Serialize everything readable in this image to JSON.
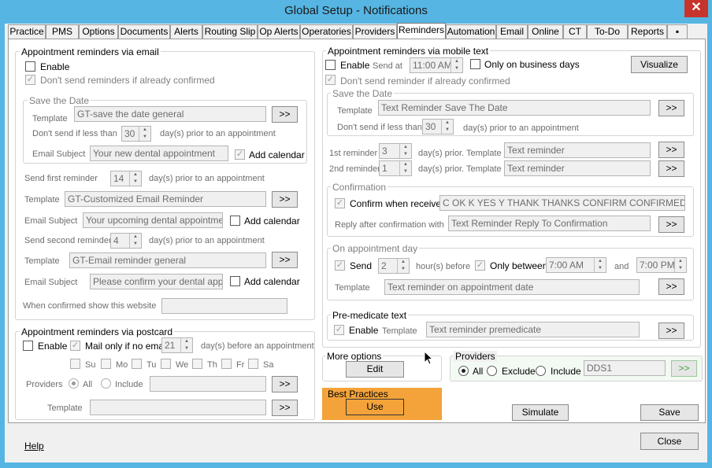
{
  "window": {
    "title": "Global Setup - Notifications",
    "close": "✕"
  },
  "tabs": [
    "Practice",
    "PMS",
    "Options",
    "Documents",
    "Alerts",
    "Routing Slip",
    "Op Alerts",
    "Operatories",
    "Providers",
    "Reminders",
    "Automation",
    "Email",
    "Online",
    "CT",
    "To-Do",
    "Reports",
    "▪"
  ],
  "email": {
    "title": "Appointment reminders via email",
    "enable": "Enable",
    "dont_send": "Don't send reminders  if already confirmed",
    "std": {
      "title": "Save the Date",
      "template_label": "Template",
      "template": "GT-save the date general",
      "browse": ">>",
      "less_label": "Don't send if less than",
      "less_value": "30",
      "days_label": "day(s) prior to an appointment",
      "subject_label": "Email Subject",
      "subject": "Your new dental appointment",
      "add_calendar": "Add calendar"
    },
    "first_label": "Send first reminder",
    "first_value": "14",
    "first_days": "day(s) prior to an appointment",
    "template1_label": "Template",
    "template1": "GT-Customized Email Reminder",
    "browse1": ">>",
    "subject1_label": "Email Subject",
    "subject1": "Your upcoming dental appointment",
    "add_calendar1": "Add calendar",
    "second_label": "Send second reminder",
    "second_value": "4",
    "second_days": "day(s) prior to an appointment",
    "template2_label": "Template",
    "template2": "GT-Email reminder general",
    "browse2": ">>",
    "subject2_label": "Email Subject",
    "subject2": "Please confirm your dental appointi",
    "add_calendar2": "Add calendar",
    "website_label": "When confirmed show this website",
    "website": ""
  },
  "postcard": {
    "title": "Appointment reminders via postcard",
    "enable": "Enable",
    "mail_only": "Mail only if no email",
    "days_value": "21",
    "days_label": "day(s) before an appointment",
    "days": [
      "Su",
      "Mo",
      "Tu",
      "We",
      "Th",
      "Fr",
      "Sa"
    ],
    "providers_label": "Providers",
    "all": "All",
    "include": "Include",
    "include_value": "",
    "browse": ">>",
    "template_label": "Template",
    "template": "",
    "browse2": ">>"
  },
  "mobile": {
    "title": "Appointment reminders via mobile text",
    "enable": "Enable",
    "send_at": "Send at",
    "time": "11:00 AM",
    "business_days": "Only on business days",
    "visualize": "Visualize",
    "dont_send": "Don't send reminder  if already confirmed",
    "std": {
      "title": "Save the Date",
      "template_label": "Template",
      "template": "Text Reminder Save The Date",
      "browse": ">>",
      "less_label": "Don't send if less than",
      "less_value": "30",
      "days_label": "day(s) prior to an appointment"
    },
    "r1_label": "1st reminder",
    "r1_value": "3",
    "r1_days": "day(s) prior.",
    "r1_tpl_label": "Template",
    "r1_tpl": "Text reminder",
    "browse1": ">>",
    "r2_label": "2nd reminder",
    "r2_value": "1",
    "r2_days": "day(s) prior.",
    "r2_tpl_label": "Template",
    "r2_tpl": "Text reminder",
    "browse2": ">>",
    "confirmation": {
      "title": "Confirmation",
      "confirm_when": "Confirm when receive",
      "keywords": "C OK K YES Y THANK THANKS CONFIRM CONFIRMED SI",
      "reply_label": "Reply after confirmation with",
      "reply": "Text Reminder Reply To Confirmation",
      "browse": ">>"
    },
    "appt_day": {
      "title": "On appointment day",
      "send": "Send",
      "hours_value": "2",
      "hours_label": "hour(s) before",
      "only_between": "Only between",
      "from": "7:00 AM",
      "and": "and",
      "to": "7:00 PM",
      "template_label": "Template",
      "template": "Text reminder on appointment date",
      "browse": ">>"
    },
    "premed": {
      "title": "Pre-medicate text",
      "enable": "Enable",
      "template_label": "Template",
      "template": "Text reminder premedicate",
      "browse": ">>"
    }
  },
  "more_options": {
    "title": "More options",
    "edit": "Edit"
  },
  "best_practices": {
    "title": "Best Practices",
    "use": "Use"
  },
  "providers": {
    "title": "Providers",
    "all": "All",
    "exclude": "Exclude",
    "include": "Include",
    "value": "DDS1",
    "browse": ">>"
  },
  "buttons": {
    "simulate": "Simulate",
    "save": "Save",
    "close": "Close",
    "help": "Help"
  },
  "check": "✓"
}
